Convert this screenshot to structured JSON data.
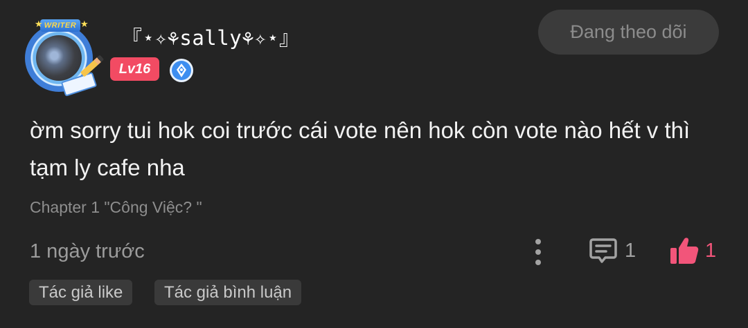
{
  "comment": {
    "author": {
      "name": "『⋆✧⚘︎sally⚘︎✧⋆』",
      "avatar_frame_label": "WRITER",
      "level": "Lv16",
      "verified_icon": "author-verified-icon"
    },
    "follow_button": "Đang theo dõi",
    "text": "ờm sorry tui hok coi trước cái vote nên hok còn vote nào hết v thì tạm ly cafe nha",
    "chapter": "Chapter 1 \"Công Việc? \"",
    "timestamp": "1 ngày trước",
    "reply_count": "1",
    "like_count": "1",
    "tags": [
      "Tác giả like",
      "Tác giả bình luận"
    ]
  },
  "colors": {
    "background": "#242424",
    "level_badge": "#f24b63",
    "like": "#f2557a",
    "muted_text": "#9c9c9c"
  }
}
